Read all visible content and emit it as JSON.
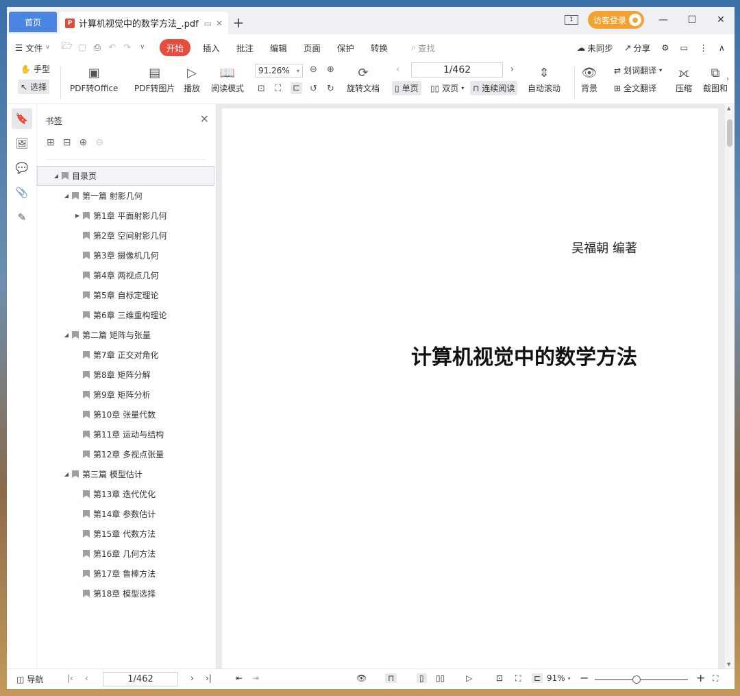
{
  "titlebar": {
    "home_tab": "首页",
    "doc_tab_title": "计算机视觉中的数学方法_.pdf",
    "add_tab": "+",
    "layout_indicator": "1",
    "login_label": "访客登录"
  },
  "menubar": {
    "file_label": "文件",
    "items": [
      "开始",
      "插入",
      "批注",
      "编辑",
      "页面",
      "保护",
      "转换"
    ],
    "search_label": "查找",
    "sync_label": "未同步",
    "share_label": "分享"
  },
  "ribbon": {
    "hand_tool": "手型",
    "select_tool": "选择",
    "pdf_to_office": "PDF转Office",
    "pdf_to_image": "PDF转图片",
    "play": "播放",
    "read_mode": "阅读模式",
    "zoom_value": "91.26%",
    "rotate_doc": "旋转文档",
    "page_value": "1/462",
    "single_page": "单页",
    "double_page": "双页",
    "continuous_read": "连续阅读",
    "auto_scroll": "自动滚动",
    "word_translate": "划词翻译",
    "full_translate": "全文翻译",
    "background": "背景",
    "compress": "压缩",
    "screenshot": "截图和"
  },
  "bookmarks": {
    "title": "书签",
    "items": [
      {
        "label": "目录页",
        "level": 0,
        "expand": "down"
      },
      {
        "label": "第一篇 射影几何",
        "level": 1,
        "expand": "down"
      },
      {
        "label": "第1章  平面射影几何",
        "level": 2,
        "expand": "right"
      },
      {
        "label": "第2章  空间射影几何",
        "level": 2,
        "expand": ""
      },
      {
        "label": "第3章  摄像机几何",
        "level": 2,
        "expand": ""
      },
      {
        "label": "第4章  两视点几何",
        "level": 2,
        "expand": ""
      },
      {
        "label": "第5章  自标定理论",
        "level": 2,
        "expand": ""
      },
      {
        "label": "第6章  三维重构理论",
        "level": 2,
        "expand": ""
      },
      {
        "label": "第二篇 矩阵与张量",
        "level": 1,
        "expand": "down"
      },
      {
        "label": "第7章  正交对角化",
        "level": 2,
        "expand": ""
      },
      {
        "label": "第8章  矩阵分解",
        "level": 2,
        "expand": ""
      },
      {
        "label": "第9章  矩阵分析",
        "level": 2,
        "expand": ""
      },
      {
        "label": "第10章  张量代数",
        "level": 2,
        "expand": ""
      },
      {
        "label": "第11章  运动与结构",
        "level": 2,
        "expand": ""
      },
      {
        "label": "第12章  多视点张量",
        "level": 2,
        "expand": ""
      },
      {
        "label": "第三篇 模型估计",
        "level": 1,
        "expand": "down"
      },
      {
        "label": "第13章  迭代优化",
        "level": 2,
        "expand": ""
      },
      {
        "label": "第14章  参数估计",
        "level": 2,
        "expand": ""
      },
      {
        "label": "第15章  代数方法",
        "level": 2,
        "expand": ""
      },
      {
        "label": "第16章  几何方法",
        "level": 2,
        "expand": ""
      },
      {
        "label": "第17章  鲁棒方法",
        "level": 2,
        "expand": ""
      },
      {
        "label": "第18章  模型选择",
        "level": 2,
        "expand": ""
      }
    ]
  },
  "page": {
    "author": "吴福朝 编著",
    "title": "计算机视觉中的数学方法"
  },
  "statusbar": {
    "nav_label": "导航",
    "page_value": "1/462",
    "zoom_value": "91%",
    "zoom_slider_fraction": 0.45
  },
  "colors": {
    "accent_blue": "#4a86e0",
    "start_red": "#e84c3d",
    "login_orange": "#f2a230"
  }
}
